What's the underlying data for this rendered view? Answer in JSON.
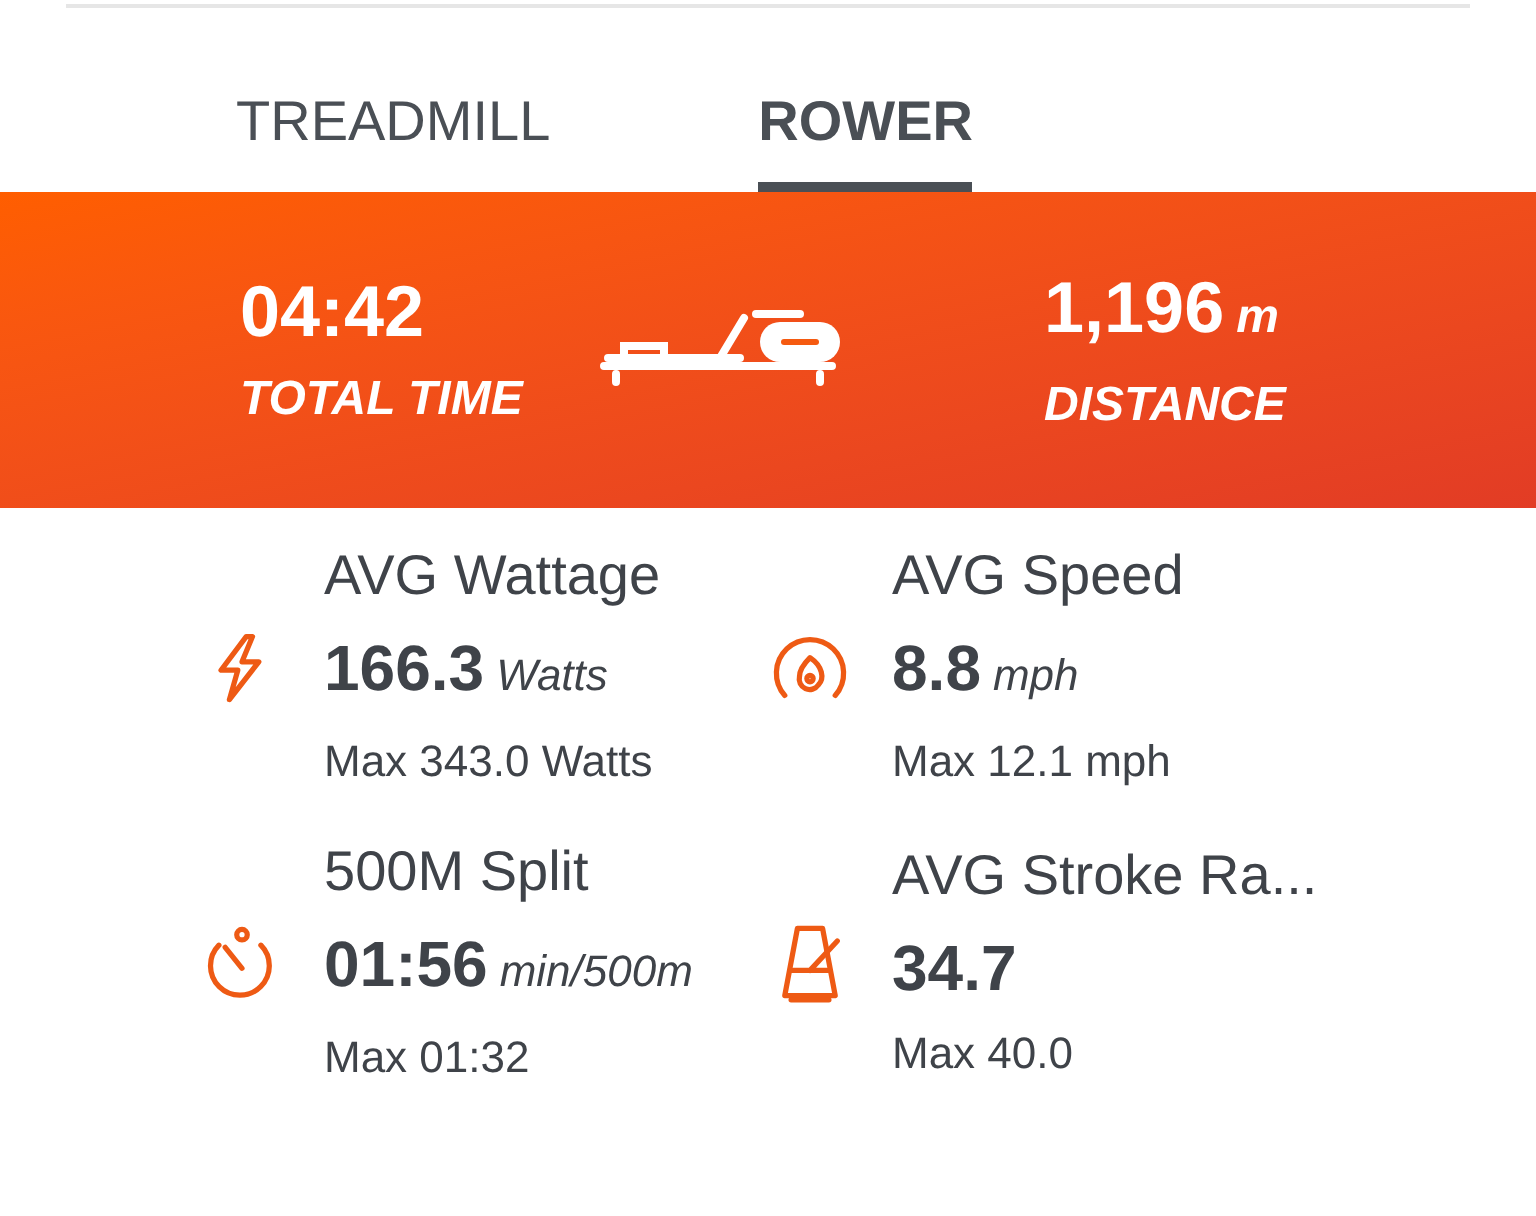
{
  "tabs": [
    {
      "label": "TREADMILL",
      "selected": false
    },
    {
      "label": "ROWER",
      "selected": true
    }
  ],
  "summary": {
    "left": {
      "value": "04:42",
      "label": "TOTAL TIME"
    },
    "right": {
      "value": "1,196",
      "unit": "m",
      "label": "DISTANCE"
    }
  },
  "stats": [
    {
      "kind": "power",
      "title": "AVG Wattage",
      "value": "166.3",
      "unit": "Watts",
      "max": "Max 343.0 Watts"
    },
    {
      "kind": "speed",
      "title": "AVG Speed",
      "value": "8.8",
      "unit": "mph",
      "max": "Max 12.1 mph"
    },
    {
      "kind": "timer",
      "title": "500M Split",
      "value": "01:56",
      "unit": "min/500m",
      "max": "Max 01:32"
    },
    {
      "kind": "cadence",
      "title": "AVG Stroke Ra...",
      "value": "34.7",
      "max": "Max 40.0"
    }
  ]
}
